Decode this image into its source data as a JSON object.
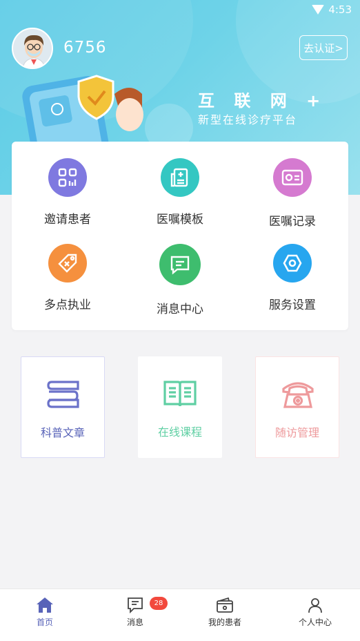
{
  "status_bar": {
    "time": "4:53"
  },
  "header": {
    "username": "6756",
    "verify_label": "去认证>",
    "slogan_title": "互 联 网 +",
    "slogan_subtitle": "新型在线诊疗平台"
  },
  "grid": [
    {
      "label": "邀请患者",
      "icon": "qr-code-icon",
      "color": "#7f79e0"
    },
    {
      "label": "医嘱模板",
      "icon": "document-plus-icon",
      "color": "#34c7c2"
    },
    {
      "label": "医嘱记录",
      "icon": "record-card-icon",
      "color": "#d57ad0"
    },
    {
      "label": "多点执业",
      "icon": "tag-icon",
      "color": "#f5903e"
    },
    {
      "label": "消息中心",
      "icon": "chat-icon",
      "color": "#3ebd6e"
    },
    {
      "label": "服务设置",
      "icon": "hex-settings-icon",
      "color": "#27a6ef"
    }
  ],
  "tiles": [
    {
      "label": "科普文章",
      "icon": "books-icon",
      "color": "#6b72c9"
    },
    {
      "label": "在线课程",
      "icon": "open-book-icon",
      "color": "#5fcfa3"
    },
    {
      "label": "随访管理",
      "icon": "telephone-icon",
      "color": "#ee9a9c"
    }
  ],
  "tabbar": [
    {
      "label": "首页",
      "icon": "home-icon",
      "active": true
    },
    {
      "label": "消息",
      "icon": "message-icon",
      "badge": "28"
    },
    {
      "label": "我的患者",
      "icon": "wallet-icon"
    },
    {
      "label": "个人中心",
      "icon": "person-icon"
    }
  ],
  "colors": {
    "primary": "#5863b8",
    "hero": "#5ccbe6",
    "badge": "#f2493d"
  }
}
